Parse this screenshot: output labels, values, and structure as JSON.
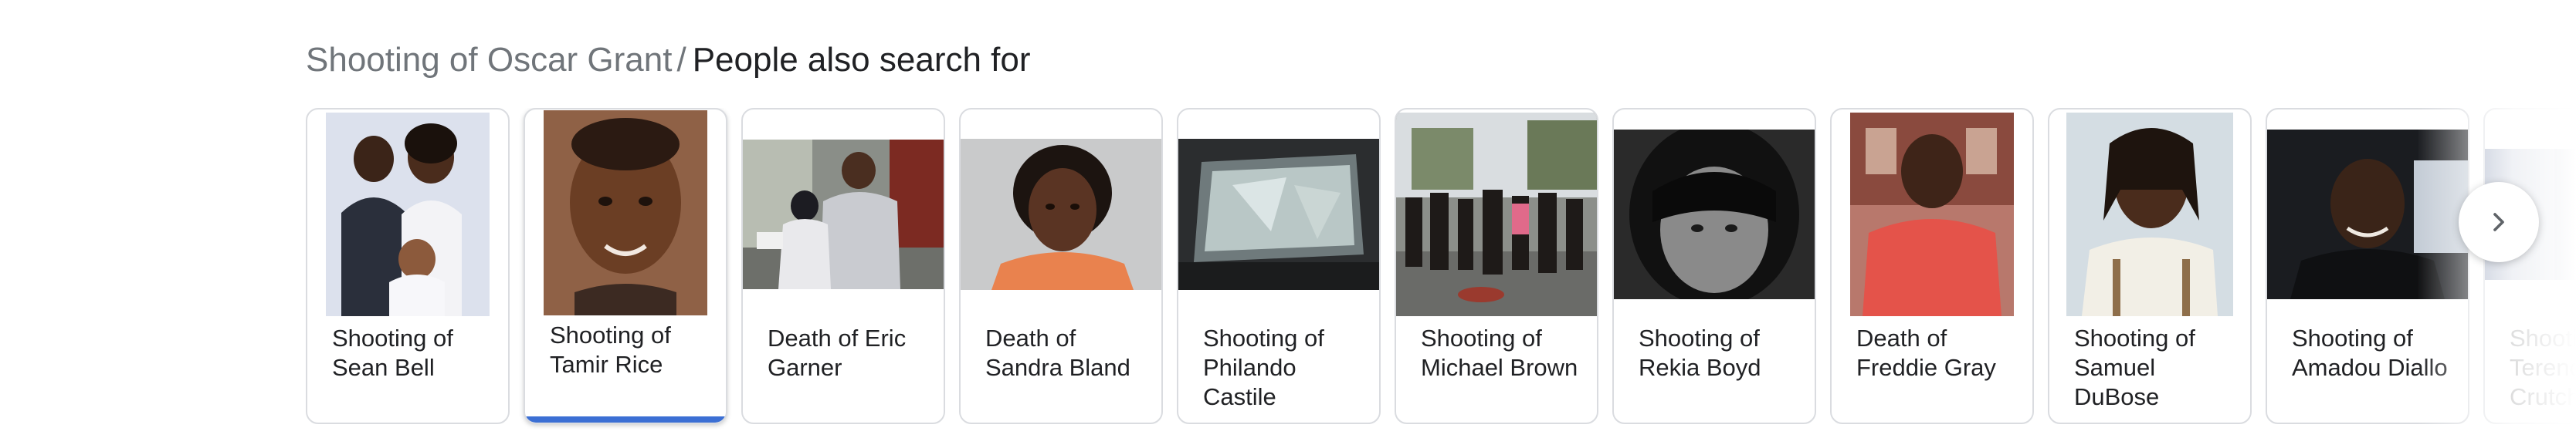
{
  "header": {
    "breadcrumb": "Shooting of Oscar Grant",
    "separator": "/",
    "title": "People also search for"
  },
  "cards": [
    {
      "label": "Shooting of Sean Bell",
      "image": "couple-with-baby-photo"
    },
    {
      "label": "Shooting of Tamir Rice",
      "image": "boy-portrait-photo"
    },
    {
      "label": "Death of Eric Garner",
      "image": "street-arrest-photo"
    },
    {
      "label": "Death of Sandra Bland",
      "image": "woman-mugshot-photo"
    },
    {
      "label": "Shooting of Philando Castile",
      "image": "car-window-photo"
    },
    {
      "label": "Shooting of Michael Brown",
      "image": "street-crowd-photo"
    },
    {
      "label": "Shooting of Rekia Boyd",
      "image": "woman-grayscale-portrait-photo"
    },
    {
      "label": "Death of Freddie Gray",
      "image": "man-red-shirt-photo"
    },
    {
      "label": "Shooting of Samuel DuBose",
      "image": "man-dreadlocks-photo"
    },
    {
      "label": "Shooting of Amadou Diallo",
      "image": "man-smiling-photo"
    },
    {
      "label": "Shooting of Terence Crutcher",
      "image": "partial-photo"
    }
  ],
  "active_card": "Shooting of Tamir Rice",
  "next_button": {
    "icon": "chevron-right-icon"
  },
  "colors": {
    "accent": "#3b6fd4",
    "breadcrumb": "#70757a",
    "title": "#202124",
    "card_border": "#dadce0"
  }
}
